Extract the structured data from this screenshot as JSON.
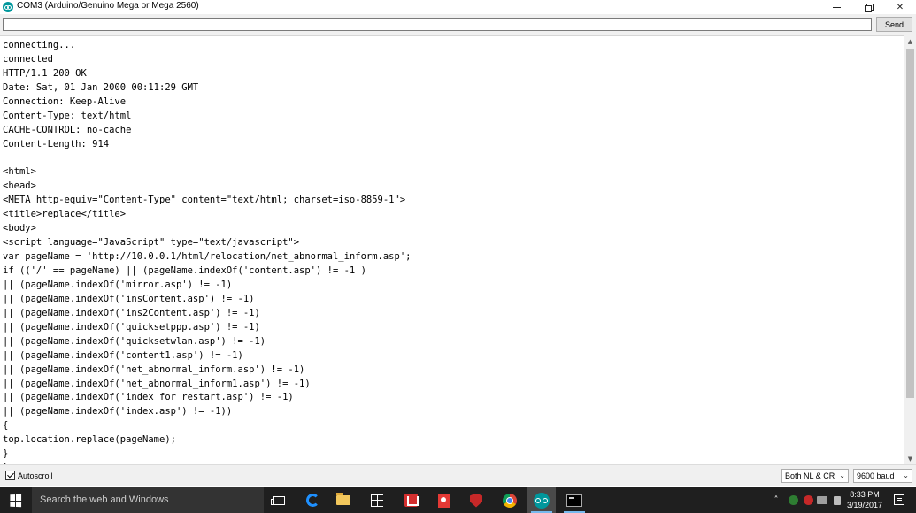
{
  "window": {
    "title": "COM3 (Arduino/Genuino Mega or Mega 2560)",
    "minimize_glyph": "—",
    "close_glyph": "✕"
  },
  "input_row": {
    "value": "",
    "send_label": "Send"
  },
  "serial_output": {
    "lines": [
      "connecting...",
      "connected",
      "HTTP/1.1 200 OK",
      "Date: Sat, 01 Jan 2000 00:11:29 GMT",
      "Connection: Keep-Alive",
      "Content-Type: text/html",
      "CACHE-CONTROL: no-cache",
      "Content-Length: 914",
      "",
      "<html>",
      "<head>",
      "<META http-equiv=\"Content-Type\" content=\"text/html; charset=iso-8859-1\">",
      "<title>replace</title>",
      "<body>",
      "<script language=\"JavaScript\" type=\"text/javascript\">",
      "var pageName = 'http://10.0.0.1/html/relocation/net_abnormal_inform.asp';",
      "if (('/' == pageName) || (pageName.indexOf('content.asp') != -1 )",
      "|| (pageName.indexOf('mirror.asp') != -1)",
      "|| (pageName.indexOf('insContent.asp') != -1)",
      "|| (pageName.indexOf('ins2Content.asp') != -1)",
      "|| (pageName.indexOf('quicksetppp.asp') != -1)",
      "|| (pageName.indexOf('quicksetwlan.asp') != -1)",
      "|| (pageName.indexOf('content1.asp') != -1)",
      "|| (pageName.indexOf('net_abnormal_inform.asp') != -1)",
      "|| (pageName.indexOf('net_abnormal_inform1.asp') != -1)",
      "|| (pageName.indexOf('index_for_restart.asp') != -1)",
      "|| (pageName.indexOf('index.asp') != -1))",
      "{",
      "top.location.replace(pageName);",
      "}",
      "}"
    ]
  },
  "statusbar": {
    "autoscroll_label": "Autoscroll",
    "autoscroll_checked": true,
    "line_ending_selected": "Both NL & CR",
    "baud_selected": "9600 baud"
  },
  "taskbar": {
    "search_placeholder": "Search the web and Windows",
    "clock_time": "8:33 PM",
    "clock_date": "3/19/2017",
    "tray_up_glyph": "˄"
  },
  "colors": {
    "arduino_teal": "#00979c",
    "taskbar_bg": "#1f1f1f",
    "active_underline": "#76b9ed"
  }
}
